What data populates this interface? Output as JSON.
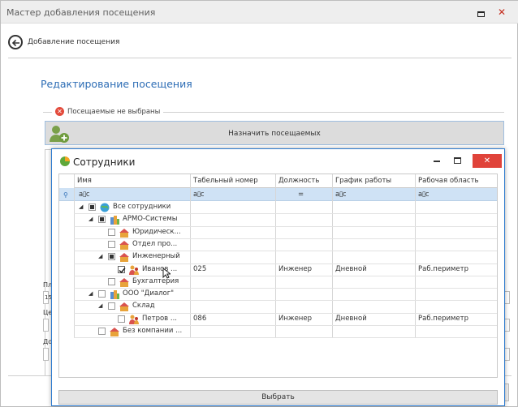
{
  "window": {
    "title": "Мастер добавления посещения",
    "close_glyph": "✕"
  },
  "wizard": {
    "step_title": "Добавление посещения",
    "section_title": "Редактирование посещения",
    "warning": "Посещаемые не выбраны",
    "assign_button": "Назначить посещаемых"
  },
  "side_labels": [
    "Пл",
    "15",
    "Це",
    "До"
  ],
  "dialog": {
    "title": "Сотрудники",
    "close_glyph": "✕",
    "columns": [
      "Имя",
      "Табельный номер",
      "Должность",
      "График работы",
      "Рабочая область"
    ],
    "filter_icons": [
      "a▯c",
      "a▯c",
      "=",
      "a▯c",
      "a▯c"
    ],
    "rows": [
      {
        "name": "Все сотрудники",
        "number": "",
        "position": "",
        "schedule": "",
        "area": "",
        "level": 0,
        "expand": "◢",
        "check": "ind",
        "icon": "globe-icon"
      },
      {
        "name": "АРМО-Системы",
        "number": "",
        "position": "",
        "schedule": "",
        "area": "",
        "level": 1,
        "expand": "◢",
        "check": "ind",
        "icon": "company-icon"
      },
      {
        "name": "Юридическ...",
        "number": "",
        "position": "",
        "schedule": "",
        "area": "",
        "level": 2,
        "expand": "",
        "check": "",
        "icon": "department-icon"
      },
      {
        "name": "Отдел про...",
        "number": "",
        "position": "",
        "schedule": "",
        "area": "",
        "level": 2,
        "expand": "",
        "check": "",
        "icon": "department-icon"
      },
      {
        "name": "Инженерный",
        "number": "",
        "position": "",
        "schedule": "",
        "area": "",
        "level": 2,
        "expand": "◢",
        "check": "ind",
        "icon": "department-icon"
      },
      {
        "name": "Иванов ...",
        "number": "025",
        "position": "Инженер",
        "schedule": "Дневной",
        "area": "Раб.периметр",
        "level": 3,
        "expand": "",
        "check": "chk",
        "icon": "person-icon"
      },
      {
        "name": "Бухгалтерия",
        "number": "",
        "position": "",
        "schedule": "",
        "area": "",
        "level": 2,
        "expand": "",
        "check": "",
        "icon": "department-icon"
      },
      {
        "name": "ООО \"Диалог\"",
        "number": "",
        "position": "",
        "schedule": "",
        "area": "",
        "level": 1,
        "expand": "◢",
        "check": "",
        "icon": "company-icon"
      },
      {
        "name": "Склад",
        "number": "",
        "position": "",
        "schedule": "",
        "area": "",
        "level": 2,
        "expand": "◢",
        "check": "",
        "icon": "department-icon"
      },
      {
        "name": "Петров ...",
        "number": "086",
        "position": "Инженер",
        "schedule": "Дневной",
        "area": "Раб.периметр",
        "level": 3,
        "expand": "",
        "check": "",
        "icon": "person-icon"
      },
      {
        "name": "Без компании ...",
        "number": "",
        "position": "",
        "schedule": "",
        "area": "",
        "level": 1,
        "expand": "",
        "check": "",
        "icon": "department-icon"
      }
    ],
    "select_button": "Выбрать"
  },
  "colors": {
    "accent": "#2d6db5",
    "filter_row": "#cfe2f5",
    "close_red": "#e0433a"
  }
}
